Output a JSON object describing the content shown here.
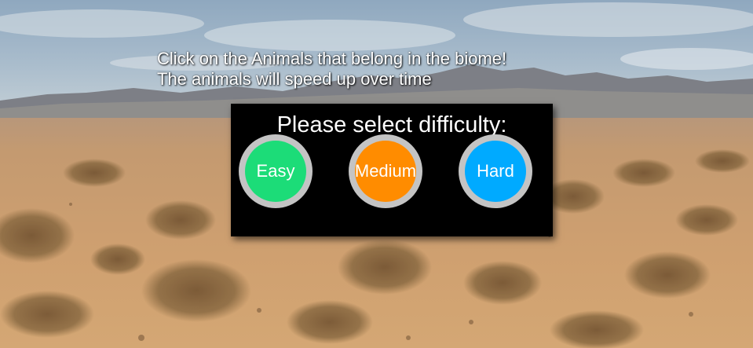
{
  "instructions": {
    "line1": "Click on the Animals that belong in the biome!",
    "line2": "The animals will speed up over time"
  },
  "difficulty_panel": {
    "title": "Please select difficulty:",
    "buttons": [
      {
        "label": "Easy",
        "color": "#1cdc78"
      },
      {
        "label": "Medium",
        "color": "#ff8c00"
      },
      {
        "label": "Hard",
        "color": "#00aaff"
      }
    ],
    "ring_color": "#c4c4c4"
  },
  "background": {
    "biome": "desert",
    "sky_color": "#9db4c8",
    "ground_color": "#c89968"
  }
}
